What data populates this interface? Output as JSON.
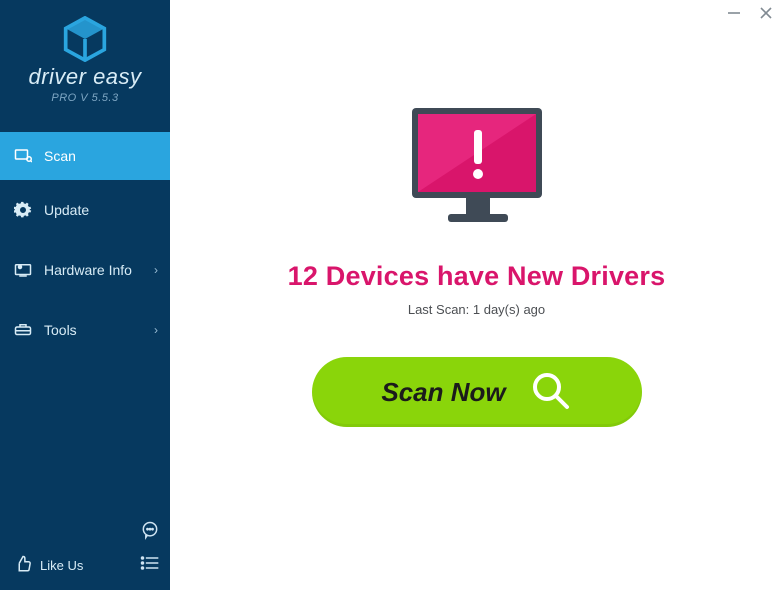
{
  "brand": {
    "name": "driver easy",
    "version": "PRO V 5.5.3"
  },
  "nav": {
    "scan": "Scan",
    "update": "Update",
    "hardware": "Hardware Info",
    "tools": "Tools"
  },
  "footer": {
    "like": "Like Us"
  },
  "main": {
    "headline": "12 Devices have New Drivers",
    "last_scan": "Last Scan: 1 day(s) ago",
    "scan_button": "Scan Now"
  }
}
